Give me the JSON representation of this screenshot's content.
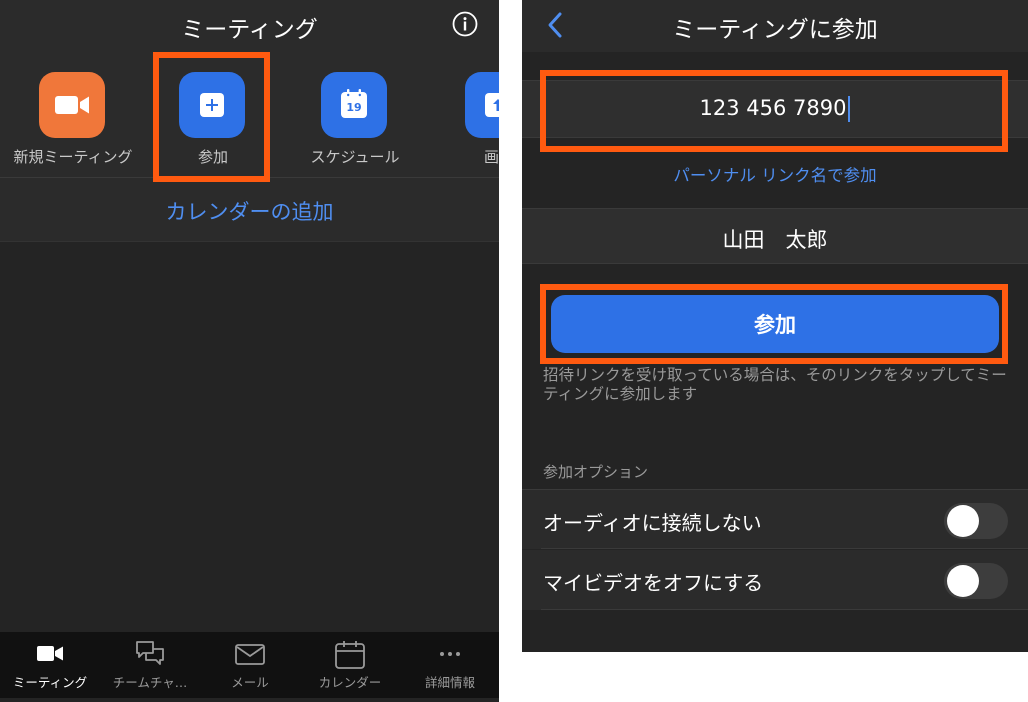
{
  "left": {
    "header": {
      "title": "ミーティング",
      "info_icon": "info-icon"
    },
    "actions": [
      {
        "label": "新規ミーティング",
        "icon": "video-camera-icon",
        "color": "#f0773a"
      },
      {
        "label": "参加",
        "icon": "plus-icon",
        "color": "#2e71e6"
      },
      {
        "label": "スケジュール",
        "icon": "calendar-icon",
        "color": "#2e71e6",
        "day": "19"
      },
      {
        "label": "画面",
        "icon": "share-screen-icon",
        "color": "#2e71e6"
      }
    ],
    "calendar_link": "カレンダーの追加",
    "tabs": [
      {
        "label": "ミーティング",
        "icon": "video-camera-icon",
        "active": true
      },
      {
        "label": "チームチャ…",
        "icon": "chat-bubbles-icon",
        "active": false
      },
      {
        "label": "メール",
        "icon": "mail-icon",
        "active": false
      },
      {
        "label": "カレンダー",
        "icon": "calendar-icon",
        "active": false
      },
      {
        "label": "詳細情報",
        "icon": "more-icon",
        "active": false
      }
    ]
  },
  "right": {
    "header": {
      "title": "ミーティングに参加",
      "back_icon": "chevron-left-icon"
    },
    "meeting_id": "123 456 7890",
    "personal_link": "パーソナル リンク名で参加",
    "name": "山田　太郎",
    "join_label": "参加",
    "invite_note": "招待リンクを受け取っている場合は、そのリンクをタップしてミーティングに参加します",
    "options_header": "参加オプション",
    "options": [
      {
        "label": "オーディオに接続しない",
        "on": false
      },
      {
        "label": "マイビデオをオフにする",
        "on": false
      }
    ]
  },
  "colors": {
    "accent": "#2e71e6",
    "link": "#4f8ef0",
    "highlight": "#ff5a10",
    "orange_tile": "#f0773a",
    "background": "#242424"
  }
}
